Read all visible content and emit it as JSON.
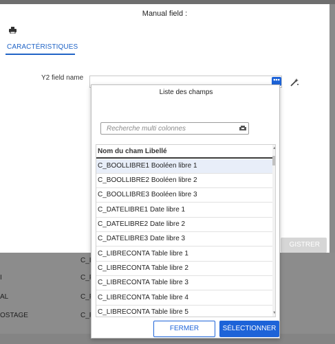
{
  "modal": {
    "title": "Manual field :",
    "tab_label": "CARACTÉRISTIQUES",
    "field_label": "Y2 field name",
    "field_value": "",
    "dots_label": "•••",
    "register_label": "GISTRER"
  },
  "picker": {
    "title": "Liste des champs",
    "search_placeholder": "Recherche multi colonnes",
    "column_header": "Nom du cham Libellé",
    "rows": [
      "C_BOOLLIBRE1 Booléen libre 1",
      "C_BOOLLIBRE2 Booléen libre 2",
      "C_BOOLLIBRE3 Booléen libre 3",
      "C_DATELIBRE1 Date libre 1",
      "C_DATELIBRE2 Date libre 2",
      "C_DATELIBRE3 Date libre 3",
      "C_LIBRECONTA Table libre 1",
      "C_LIBRECONTA Table libre 2",
      "C_LIBRECONTA Table libre 3",
      "C_LIBRECONTA Table libre 4",
      "C_LIBRECONTA Table libre 5"
    ],
    "selected_row": 0,
    "close_label": "FERMER",
    "select_label": "SÉLECTIONNER"
  },
  "background": {
    "rows": [
      {
        "left": "",
        "right": "C_I"
      },
      {
        "left": "I",
        "right": "C_F"
      },
      {
        "left": "AL",
        "right": "C_F"
      },
      {
        "left": "OSTAGE",
        "right": "C_F"
      }
    ]
  },
  "colors": {
    "accent": "#1d63d8",
    "tab": "#1f63c6",
    "selected_row": "#e8eef9",
    "overlay": "#8f8f8f"
  },
  "icons": {
    "printer": "printer-icon",
    "wand": "magic-wand-icon",
    "search": "search-icon",
    "more": "more-options-icon"
  }
}
